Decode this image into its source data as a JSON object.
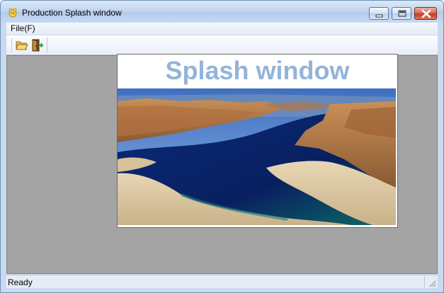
{
  "window": {
    "title": "Production Splash window"
  },
  "menubar": {
    "items": [
      {
        "label": "File(F)"
      }
    ]
  },
  "toolbar": {
    "buttons": [
      {
        "icon": "folder-open-icon"
      },
      {
        "icon": "exit-door-icon"
      }
    ]
  },
  "splash": {
    "title": "Splash window",
    "title_color": "#94b4d8",
    "image": "canyon-lake-photo"
  },
  "statusbar": {
    "text": "Ready"
  },
  "colors": {
    "client_bg": "#a4a4a4",
    "close_button": "#c43b22"
  }
}
